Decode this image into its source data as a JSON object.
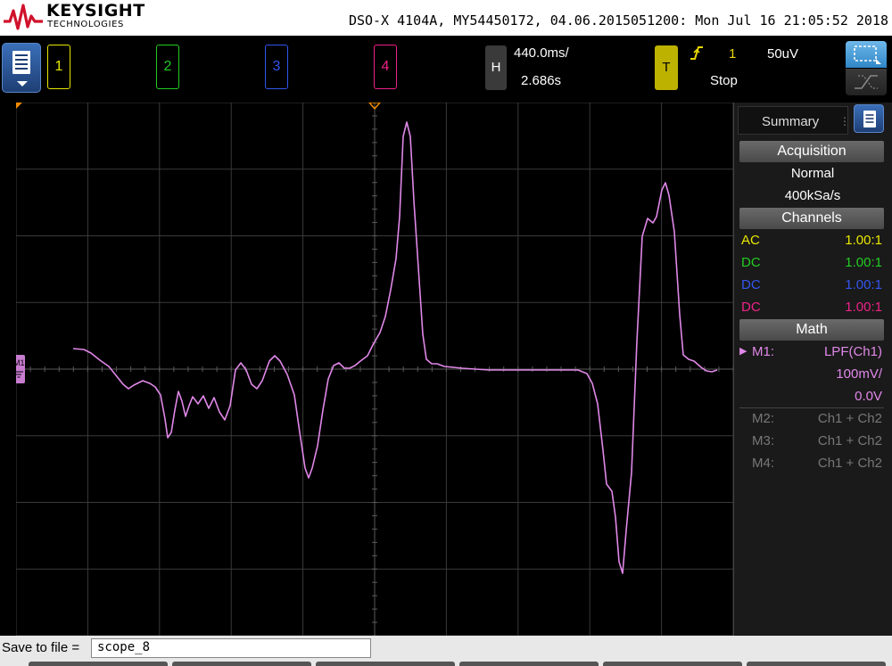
{
  "header": {
    "brand": "KEYSIGHT",
    "brand_sub": "TECHNOLOGIES",
    "instrument_info": "DSO-X 4104A, MY54450172, 04.06.2015051200: Mon Jul 16 21:05:52 2018"
  },
  "colors": {
    "ch1": "#e8e800",
    "ch2": "#22cc22",
    "ch3": "#3355ee",
    "ch4": "#ee2288",
    "math": "#e088e8"
  },
  "channels": [
    {
      "label": "1"
    },
    {
      "label": "2"
    },
    {
      "label": "3"
    },
    {
      "label": "4"
    }
  ],
  "horizontal": {
    "key": "H",
    "timebase": "440.0ms/",
    "position": "2.686s"
  },
  "trigger": {
    "key": "T",
    "source": "1",
    "level": "50uV",
    "status": "Stop"
  },
  "panel": {
    "tab_label": "Summary",
    "acquisition_header": "Acquisition",
    "acq_mode": "Normal",
    "sample_rate": "400kSa/s",
    "channels_header": "Channels",
    "channel_rows": [
      {
        "coupling": "AC",
        "probe": "1.00:1"
      },
      {
        "coupling": "DC",
        "probe": "1.00:1"
      },
      {
        "coupling": "DC",
        "probe": "1.00:1"
      },
      {
        "coupling": "DC",
        "probe": "1.00:1"
      }
    ],
    "math_header": "Math",
    "math_rows": [
      {
        "name": "M1:",
        "func": "LPF(Ch1)",
        "scale": "100mV/",
        "offset": "0.0V"
      },
      {
        "name": "M2:",
        "func": "Ch1 + Ch2"
      },
      {
        "name": "M3:",
        "func": "Ch1 + Ch2"
      },
      {
        "name": "M4:",
        "func": "Ch1 + Ch2"
      }
    ]
  },
  "graticule": {
    "marker_label": "M1"
  },
  "save": {
    "label": "Save to file =",
    "filename": "scope_8"
  }
}
